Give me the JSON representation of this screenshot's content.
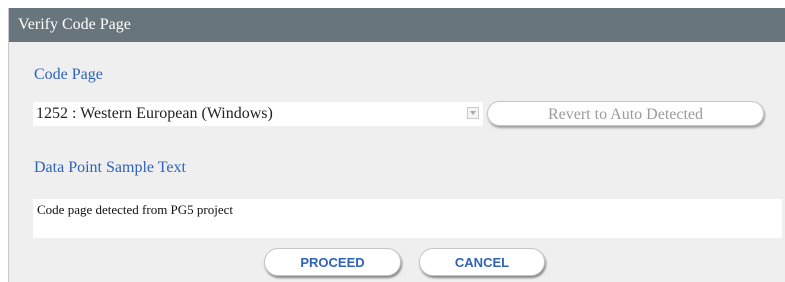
{
  "dialog": {
    "title": "Verify Code Page"
  },
  "code_page": {
    "label": "Code Page",
    "selected": "1252 : Western European (Windows)",
    "revert_label": "Revert to Auto Detected"
  },
  "sample": {
    "label": "Data Point Sample Text",
    "text": "Code page detected from PG5 project"
  },
  "actions": {
    "proceed_label": "PROCEED",
    "cancel_label": "CANCEL"
  },
  "colors": {
    "titlebar": "#69757c",
    "label_blue": "#2f63b8",
    "dialog_bg": "#efefef"
  },
  "icons": {
    "dropdown": "chevron-down-icon"
  }
}
